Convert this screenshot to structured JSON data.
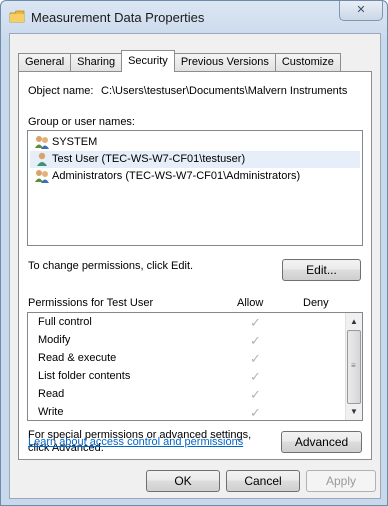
{
  "window": {
    "title": "Measurement Data Properties",
    "close_glyph": "✕"
  },
  "tabs": [
    {
      "label": "General"
    },
    {
      "label": "Sharing"
    },
    {
      "label": "Security",
      "active": true
    },
    {
      "label": "Previous Versions"
    },
    {
      "label": "Customize"
    }
  ],
  "security": {
    "object_name_label": "Object name:",
    "object_name_value": "C:\\Users\\testuser\\Documents\\Malvern Instruments",
    "group_label": "Group or user names:",
    "users": [
      {
        "name": "SYSTEM",
        "icon": "group-users-icon"
      },
      {
        "name": "Test User (TEC-WS-W7-CF01\\testuser)",
        "icon": "user-icon",
        "selected": true
      },
      {
        "name": "Administrators (TEC-WS-W7-CF01\\Administrators)",
        "icon": "group-users-icon"
      }
    ],
    "change_text": "To change permissions, click Edit.",
    "edit_button": "Edit...",
    "permissions_for": "Permissions for Test User",
    "allow_header": "Allow",
    "deny_header": "Deny",
    "permissions": [
      {
        "name": "Full control",
        "allow": "✓"
      },
      {
        "name": "Modify",
        "allow": "✓"
      },
      {
        "name": "Read & execute",
        "allow": "✓"
      },
      {
        "name": "List folder contents",
        "allow": "✓"
      },
      {
        "name": "Read",
        "allow": "✓"
      },
      {
        "name": "Write",
        "allow": "✓"
      }
    ],
    "special_text_1": "For special permissions or advanced settings,",
    "special_text_2": "click Advanced.",
    "advanced_button": "Advanced",
    "learn_link": "Learn about access control and permissions"
  },
  "footer": {
    "ok": "OK",
    "cancel": "Cancel",
    "apply": "Apply"
  },
  "colors": {
    "accent_link": "#0066cc",
    "selection": "#e5eef9",
    "checkmark_disabled": "#b4b4b4"
  }
}
